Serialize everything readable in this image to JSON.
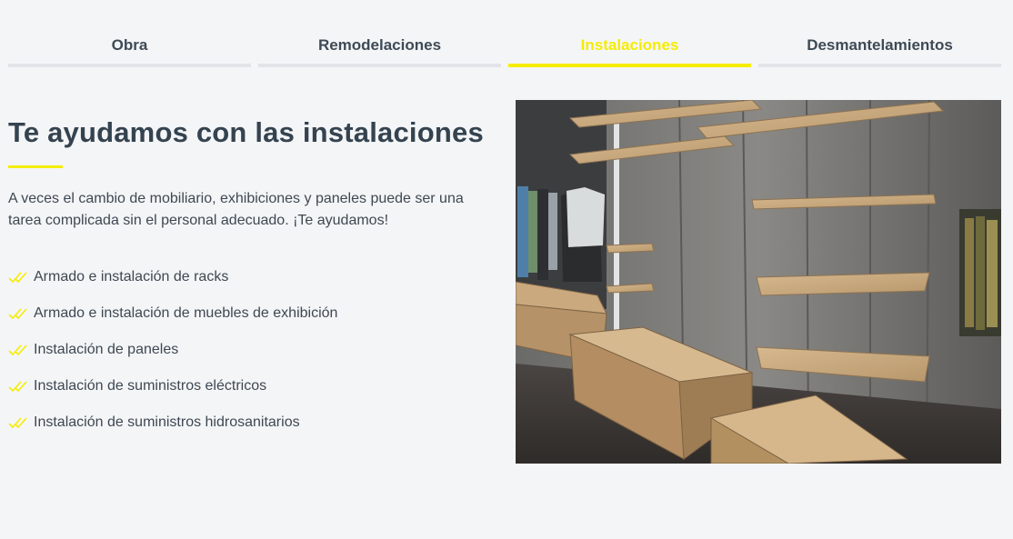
{
  "tabs": [
    {
      "label": "Obra",
      "active": false
    },
    {
      "label": "Remodelaciones",
      "active": false
    },
    {
      "label": "Instalaciones",
      "active": true
    },
    {
      "label": "Desmantelamientos",
      "active": false
    }
  ],
  "section": {
    "title": "Te ayudamos con las instalaciones",
    "intro": "A veces el cambio de mobiliario, exhibiciones y paneles puede ser una tarea complicada sin el personal adecuado. ¡Te ayudamos!",
    "features": [
      "Armado e instalación de racks",
      "Armado e instalación de muebles de exhibición",
      "Instalación de paneles",
      "Instalación de suministros eléctricos",
      "Instalación de suministros hidrosanitarios"
    ]
  },
  "colors": {
    "accent": "#f5ed00",
    "text": "#3e4852",
    "heading": "#34434f",
    "background": "#f4f5f7",
    "tab_inactive_bar": "#e2e4e8"
  },
  "icons": {
    "feature_bullet": "double-check-icon"
  }
}
